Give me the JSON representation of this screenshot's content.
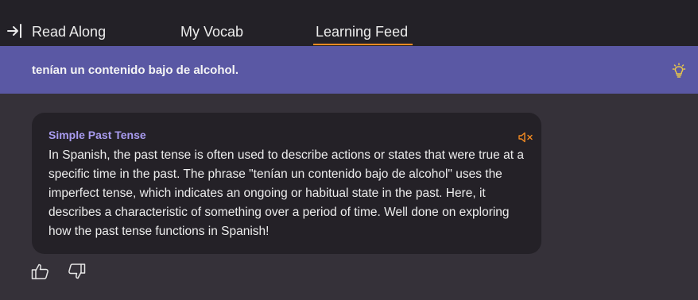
{
  "tabs": {
    "read_along": "Read Along",
    "my_vocab": "My Vocab",
    "learning_feed": "Learning Feed",
    "active": "learning_feed"
  },
  "banner": {
    "text": "tenían un contenido bajo de alcohol."
  },
  "card": {
    "title": "Simple Past Tense",
    "body": "In Spanish, the past tense is often used to describe actions or states that were true at a specific time in the past. The phrase \"tenían un contenido bajo de alcohol\" uses the imperfect tense, which indicates an ongoing or habitual state in the past. Here, it describes a characteristic of something over a period of time. Well done on exploring how the past tense functions in Spanish!"
  },
  "icons": {
    "collapse": "arrow-right-bar-icon",
    "bulb": "lightbulb-icon",
    "mute": "speaker-muted-icon",
    "thumbs_up": "thumbs-up-icon",
    "thumbs_down": "thumbs-down-icon"
  },
  "colors": {
    "accent_orange": "#f28a22",
    "banner_bg": "#5a58a4",
    "card_title": "#a99cf0",
    "bulb": "#e8c64a"
  }
}
